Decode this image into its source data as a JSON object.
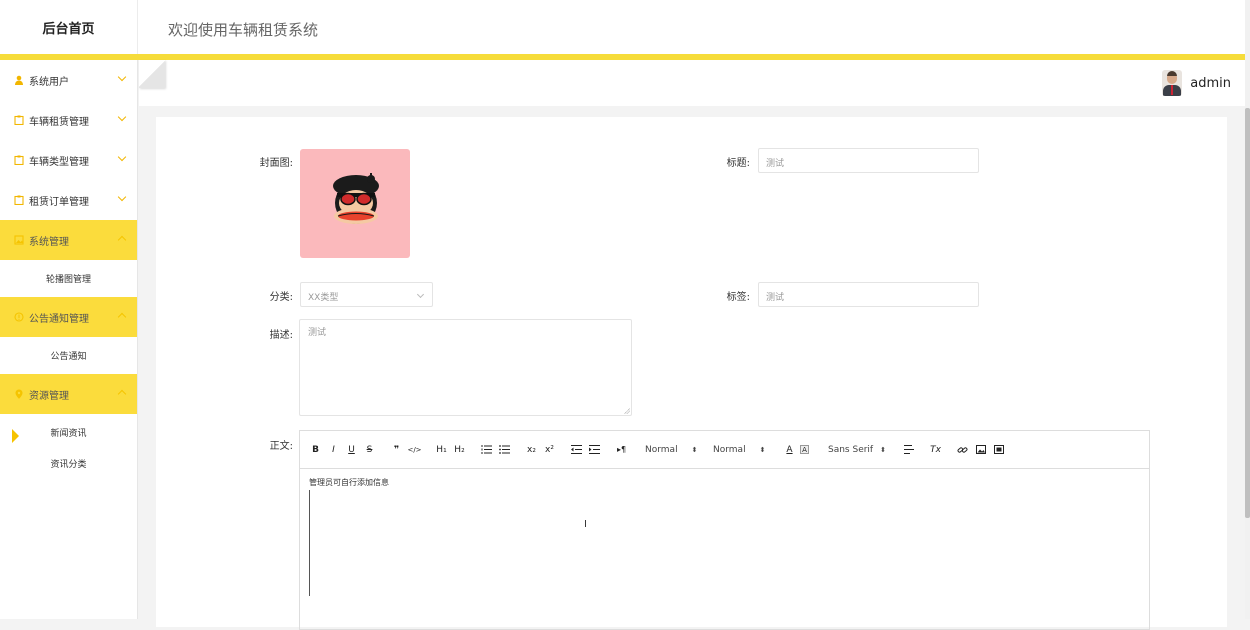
{
  "header": {
    "brand": "后台首页",
    "title": "欢迎使用车辆租赁系统"
  },
  "user": {
    "name": "admin"
  },
  "sidebar": {
    "items": [
      {
        "label": "系统用户",
        "icon": "user-icon",
        "expanded": false
      },
      {
        "label": "车辆租赁管理",
        "icon": "clipboard-icon",
        "expanded": false
      },
      {
        "label": "车辆类型管理",
        "icon": "clipboard-icon",
        "expanded": false
      },
      {
        "label": "租赁订单管理",
        "icon": "clipboard-icon",
        "expanded": false
      },
      {
        "label": "系统管理",
        "icon": "image-icon",
        "expanded": true,
        "children": [
          "轮播图管理"
        ]
      },
      {
        "label": "公告通知管理",
        "icon": "info-icon",
        "expanded": true,
        "children": [
          "公告通知"
        ]
      },
      {
        "label": "资源管理",
        "icon": "location-icon",
        "expanded": true,
        "children": [
          "新闻资讯",
          "资讯分类"
        ],
        "current_child": "新闻资讯"
      }
    ]
  },
  "form": {
    "cover_label": "封面图:",
    "title_label": "标题:",
    "title_value": "测试",
    "category_label": "分类:",
    "category_value": "XX类型",
    "tag_label": "标签:",
    "tag_value": "测试",
    "desc_label": "描述:",
    "desc_value": "测试",
    "body_label": "正文:",
    "body_value": "管理员可自行添加信息"
  },
  "editor_toolbar": {
    "header_select": "Normal",
    "size_select": "Normal",
    "font_select": "Sans Serif",
    "bold": "B",
    "italic": "I",
    "underline": "U",
    "strike": "S",
    "quote": "❞",
    "code": "</>",
    "h1": "H₁",
    "h2": "H₂",
    "sub": "x₂",
    "sup": "x²",
    "rtl": "▸¶",
    "color": "A",
    "bg": "A",
    "clean": "Tx"
  },
  "colors": {
    "accent": "#fbdc3c",
    "cover_bg": "#fbb9bc"
  }
}
